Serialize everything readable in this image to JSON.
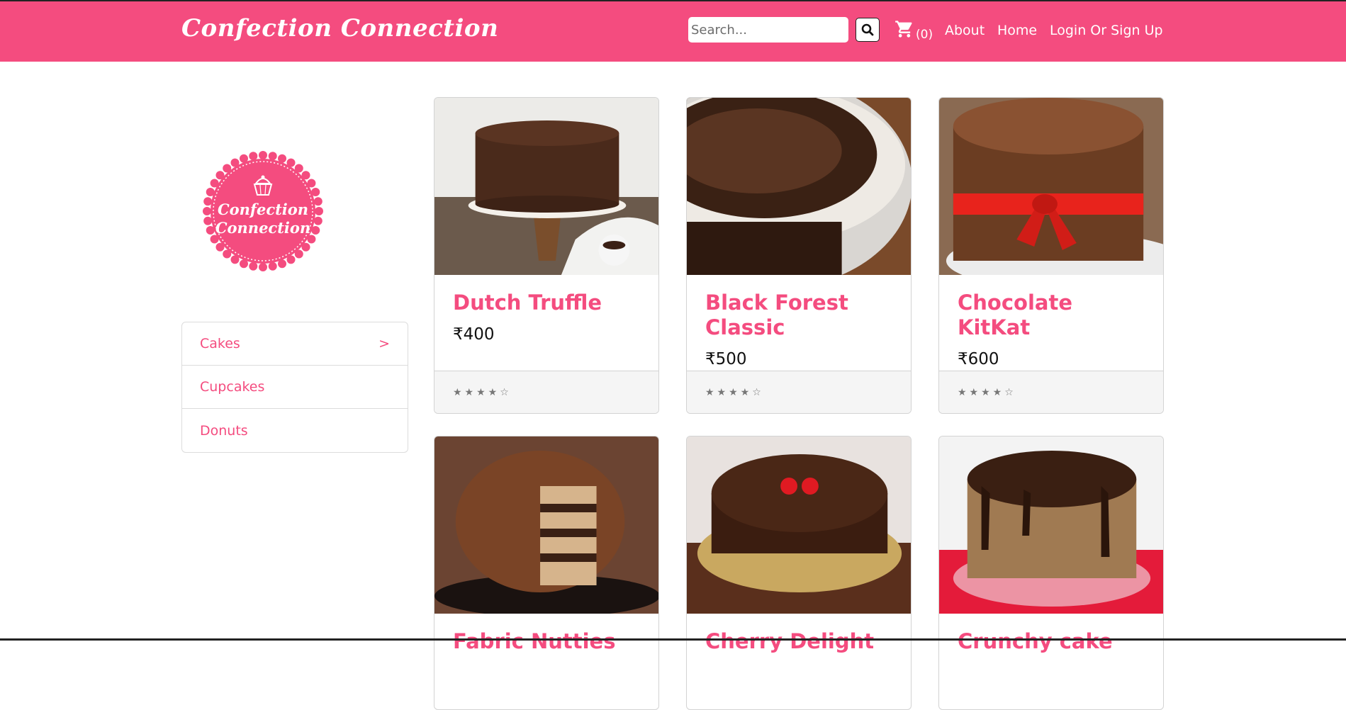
{
  "brand": "Confection Connection",
  "logo_text": "Confection Connection",
  "colors": {
    "accent": "#f44c7f",
    "text": "#111111",
    "footer_bg": "#f5f5f5"
  },
  "search": {
    "placeholder": "Search...",
    "icon": "search-icon"
  },
  "cart": {
    "icon": "cart-icon",
    "count": "(0)"
  },
  "nav": {
    "about": "About",
    "home": "Home",
    "login": "Login Or Sign Up"
  },
  "sidebar": {
    "items": [
      {
        "label": "Cakes",
        "marker": ">"
      },
      {
        "label": "Cupcakes",
        "marker": ""
      },
      {
        "label": "Donuts",
        "marker": ""
      }
    ]
  },
  "products": [
    {
      "title": "Dutch Truffle",
      "price": "₹400",
      "rating": "★★★★☆"
    },
    {
      "title": "Black Forest Classic",
      "price": "₹500",
      "rating": "★★★★☆"
    },
    {
      "title": "Chocolate KitKat",
      "price": "₹600",
      "rating": "★★★★☆"
    },
    {
      "title": "Fabric Nutties",
      "price": "",
      "rating": ""
    },
    {
      "title": "Cherry Delight",
      "price": "",
      "rating": ""
    },
    {
      "title": "Crunchy cake",
      "price": "",
      "rating": ""
    }
  ]
}
